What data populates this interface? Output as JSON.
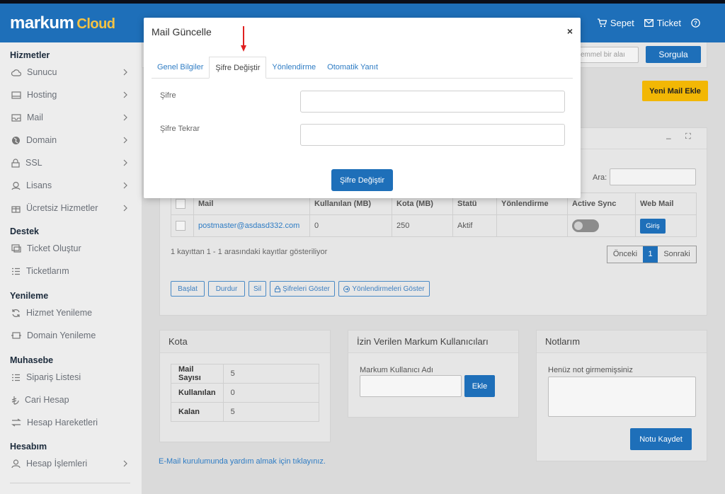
{
  "header": {
    "logo_main": "markum",
    "logo_sub": "Cloud",
    "cart_label": "Sepet",
    "ticket_label": "Ticket"
  },
  "sidebar": {
    "sections": {
      "services": "Hizmetler",
      "support": "Destek",
      "renewal": "Yenileme",
      "accounting": "Muhasebe",
      "account": "Hesabım"
    },
    "items": [
      "Sunucu",
      "Hosting",
      "Mail",
      "Domain",
      "SSL",
      "Lisans",
      "Ücretsiz Hizmetler",
      "Ticket Oluştur",
      "Ticketlarım",
      "Hizmet Yenileme",
      "Domain Yenileme",
      "Sipariş Listesi",
      "Cari Hesap",
      "Hesap Hareketleri",
      "Hesap İşlemleri"
    ]
  },
  "topbar": {
    "search_placeholder": "emmel bir alaı",
    "query_button": "Sorgula",
    "new_mail_button": "Yeni Mail Ekle"
  },
  "table": {
    "search_label": "Ara:",
    "columns": [
      "Mail",
      "Kullanılan (MB)",
      "Kota (MB)",
      "Statü",
      "Yönlendirme",
      "Active Sync",
      "Web Mail"
    ],
    "row": {
      "mail": "postmaster@asdasd332.com",
      "used": "0",
      "quota": "250",
      "status": "Aktif",
      "forward": "",
      "login_button": "Giriş"
    },
    "info": "1 kayıttan 1 - 1 arasındaki kayıtlar gösteriliyor",
    "prev": "Önceki",
    "page": "1",
    "next": "Sonraki",
    "actions": {
      "start": "Başlat",
      "stop": "Durdur",
      "delete": "Sil",
      "show_passwords": "Şifreleri Göster",
      "show_forwards": "Yönlendirmeleri Göster"
    }
  },
  "kota": {
    "title": "Kota",
    "rows": [
      {
        "key": "Mail Sayısı",
        "value": "5"
      },
      {
        "key": "Kullanılan",
        "value": "0"
      },
      {
        "key": "Kalan",
        "value": "5"
      }
    ]
  },
  "allowed": {
    "title": "İzin Verilen Markum Kullanıcıları",
    "field_label": "Markum Kullanıcı Adı",
    "add_button": "Ekle"
  },
  "notes": {
    "title": "Notlarım",
    "placeholder": "Henüz not girmemişsiniz",
    "save_button": "Notu Kaydet"
  },
  "help_link": "E-Mail kurulumunda yardım almak için tıklayınız.",
  "modal": {
    "title": "Mail Güncelle",
    "close": "×",
    "tabs": [
      "Genel Bilgiler",
      "Şifre Değiştir",
      "Yönlendirme",
      "Otomatik Yanıt"
    ],
    "password_label": "Şifre",
    "password_repeat_label": "Şifre Tekrar",
    "submit_button": "Şifre Değiştir"
  },
  "colors": {
    "primary": "#1e6fb9",
    "accent_yellow": "#f6c343",
    "arrow_red": "#e02020"
  }
}
